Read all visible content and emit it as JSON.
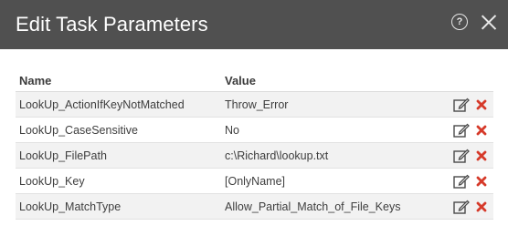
{
  "dialog": {
    "title": "Edit Task Parameters",
    "help_icon": "help-circle-icon",
    "close_icon": "close-icon"
  },
  "table": {
    "headers": {
      "name": "Name",
      "value": "Value"
    },
    "rows": [
      {
        "name": "LookUp_ActionIfKeyNotMatched",
        "value": "Throw_Error"
      },
      {
        "name": "LookUp_CaseSensitive",
        "value": "No"
      },
      {
        "name": "LookUp_FilePath",
        "value": "c:\\Richard\\lookup.txt"
      },
      {
        "name": "LookUp_Key",
        "value": "[OnlyName]"
      },
      {
        "name": "LookUp_MatchType",
        "value": "Allow_Partial_Match_of_File_Keys"
      }
    ],
    "row_icons": {
      "edit": "edit-pencil-icon",
      "delete": "delete-x-icon"
    }
  },
  "colors": {
    "titlebar": "#505050",
    "delete": "#d63a2a",
    "stripe": "#f2f2f2"
  }
}
